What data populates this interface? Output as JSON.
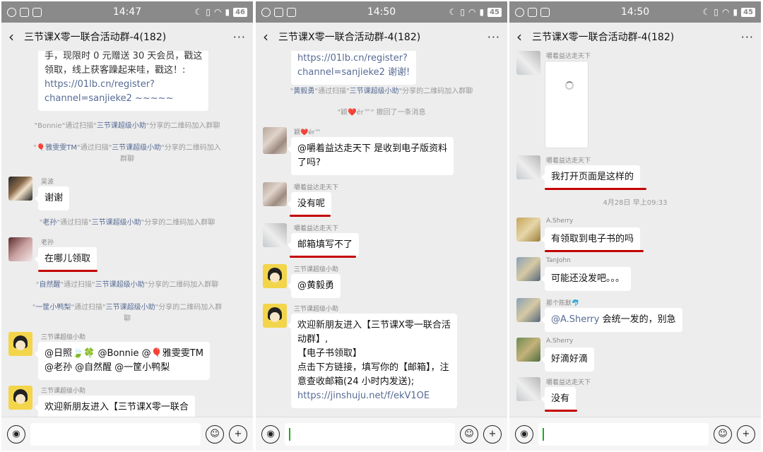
{
  "status": {
    "p1": {
      "time": "14:47",
      "battery": "46"
    },
    "p2": {
      "time": "14:50",
      "battery": "45"
    },
    "p3": {
      "time": "14:50",
      "battery": "45"
    }
  },
  "chat_title": "三节课X零一联合活动群-4(182)",
  "icons": {
    "back": "chevron-left-icon",
    "more": "more-dots-icon",
    "voice": "voice-icon",
    "emoji": "emoji-icon",
    "plus": "plus-icon"
  },
  "accent": {
    "link": "#576b95",
    "underline": "#c40000",
    "caret": "#1aad19"
  },
  "p1": {
    "top_bubble": [
      "手，现限时 0 元赠送 30 天会员，戳这",
      "领取，线上获客躁起来哇，戳这！:",
      "https://01lb.cn/register?",
      "channel=sanjieke2 ~~~~~"
    ],
    "sys1": {
      "pre": "\"Bonnie\"通过扫描\"",
      "name": "三节课超级小助",
      "post": "\"分享的二维码加入群聊"
    },
    "sys2": {
      "name1": "🎈雅雯雯TM",
      "pre": "\"通过扫描\"",
      "name": "三节课超级小助",
      "post": "\"分享的二维码加入",
      "line2": "群聊"
    },
    "m1": {
      "sender": "吴波",
      "text": "谢谢"
    },
    "sys3": {
      "name1": "老孙",
      "pre": "\"通过扫描\"",
      "name": "三节课超级小助",
      "post": "\"分享的二维码加入群聊"
    },
    "m2": {
      "sender": "老孙",
      "text": "在哪儿领取"
    },
    "sys4": {
      "name1": "自然醒",
      "pre": "\"通过扫描\"",
      "name": "三节课超级小助",
      "post": "\"分享的二维码加入群聊"
    },
    "sys5": {
      "name1": "一筐小鸭梨",
      "pre": "\"通过扫描\"",
      "name": "三节课超级小助",
      "post": "\"分享的二维码加入群",
      "line2": "聊"
    },
    "m3": {
      "sender": "三节课超级小助",
      "line1": "@日照🍃🍀 @Bonnie @🎈雅雯雯TM",
      "line2": "@老孙 @自然醒 @一筐小鸭梨"
    },
    "m4": {
      "sender": "三节课超级小助",
      "text": "欢迎新朋友进入【三节课Ⅹ零一联合"
    }
  },
  "p2": {
    "top_bubble": [
      "https://01lb.cn/register?",
      "channel=sanjieke2 谢谢!"
    ],
    "sys1": {
      "name1": "黄毅勇",
      "pre": "\"通过扫描\"",
      "name": "三节课超级小助",
      "post": "\"分享的二维码加入群聊"
    },
    "sys2": "\"颖❤️ér™\" 撤回了一条消息",
    "m1": {
      "sender": "颖❤️ér™",
      "line1": "@嚼着益达走天下  是收到电子版资料",
      "line2": "了吗?"
    },
    "m2": {
      "sender": "嚼着益达走天下",
      "text": "没有呢"
    },
    "m3": {
      "sender": "嚼着益达走天下",
      "text": "邮箱填写不了"
    },
    "m4": {
      "sender": "三节课超级小助",
      "text": "@黄毅勇"
    },
    "m5": {
      "sender": "三节课超级小助",
      "lines": [
        "欢迎新朋友进入【三节课Ⅹ零一联合活",
        "动群】,",
        "【电子书领取】",
        "点击下方链接，填写你的【邮箱】，注",
        "意查收邮箱(24 小时内发送);"
      ],
      "link": "https://jinshuju.net/f/ekV1OE"
    }
  },
  "p3": {
    "m1": {
      "sender": "嚼着益达走天下"
    },
    "m2": {
      "sender": "嚼着益达走天下",
      "text": "我打开页面是这样的"
    },
    "time": "4月28日 早上09:33",
    "m3": {
      "sender": "A.Sherry",
      "text": "有领取到电子书的吗"
    },
    "m4": {
      "sender": "TanJohn",
      "text": "可能还没发吧。。。"
    },
    "m5": {
      "sender": "那个陈默🐬",
      "mention": "@A.Sherry",
      "text": " 会统一发的，别急"
    },
    "m6": {
      "sender": "A.Sherry",
      "text": "好滴好滴"
    },
    "m7": {
      "sender": "嚼着益达走天下",
      "text": "没有"
    }
  }
}
